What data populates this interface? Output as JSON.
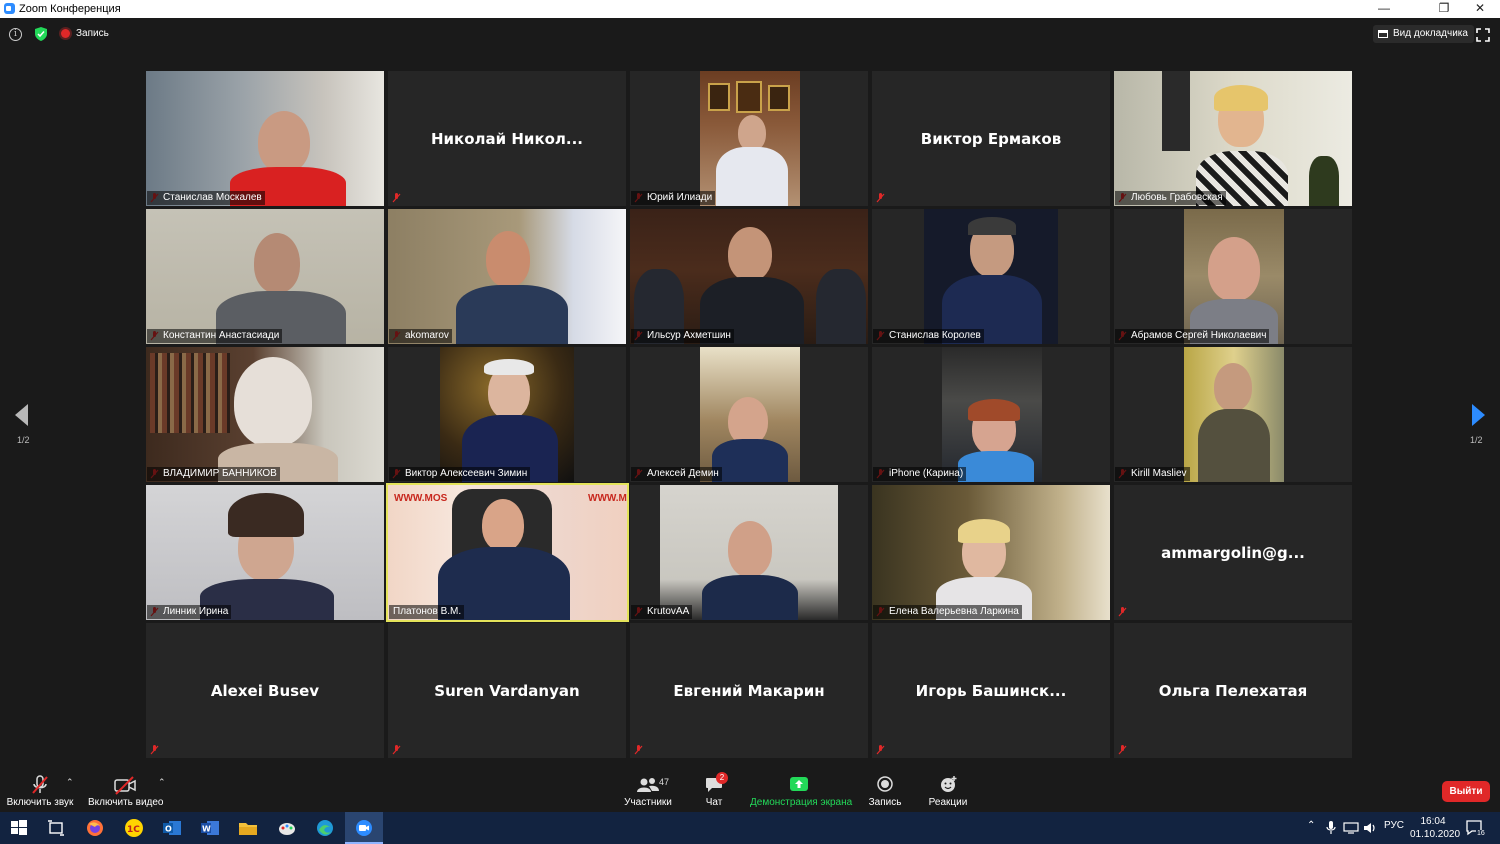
{
  "window": {
    "title": "Zoom Конференция",
    "minimize": "—",
    "restore": "❐",
    "close": "✕"
  },
  "topbar": {
    "record_label": "Запись",
    "speaker_view_label": "Вид докладчика",
    "info_glyph": "i"
  },
  "pagination": {
    "left": "1/2",
    "right": "1/2"
  },
  "colors": {
    "accent": "#2d8cff",
    "active_speaker": "#e4e35a",
    "leave": "#e02828",
    "share_green": "#23d959"
  },
  "participants": [
    {
      "name": "Станислав Москалев",
      "video": true
    },
    {
      "name": "Николай  Никол...",
      "video": false
    },
    {
      "name": "Юрий Илиади",
      "video": true
    },
    {
      "name": "Виктор Ермаков",
      "video": false
    },
    {
      "name": "Любовь Грабовская",
      "video": true
    },
    {
      "name": "Константин Анастасиади",
      "video": true
    },
    {
      "name": "akomarov",
      "video": true
    },
    {
      "name": "Ильсур Ахметшин",
      "video": true
    },
    {
      "name": "Станислав Королев",
      "video": true
    },
    {
      "name": "Абрамов Сергей Николаевич",
      "video": true
    },
    {
      "name": "ВЛАДИМИР БАННИКОВ",
      "video": true
    },
    {
      "name": "Виктор Алексеевич Зимин",
      "video": true
    },
    {
      "name": "Алексей Демин",
      "video": true
    },
    {
      "name": "iPhone (Карина)",
      "video": true
    },
    {
      "name": "Kirill Masliev",
      "video": true
    },
    {
      "name": "Линник Ирина",
      "video": true
    },
    {
      "name": "Платонов В.М.",
      "video": true,
      "active": true
    },
    {
      "name": "KrutovAA",
      "video": true
    },
    {
      "name": "Елена Валерьевна Ларкина",
      "video": true
    },
    {
      "name": "ammargolin@g...",
      "video": false
    },
    {
      "name": "Alexei Busev",
      "video": false
    },
    {
      "name": "Suren Vardanyan",
      "video": false
    },
    {
      "name": "Евгений Макарин",
      "video": false
    },
    {
      "name": "Игорь  Башинск...",
      "video": false
    },
    {
      "name": "Ольга Пелехатая",
      "video": false
    }
  ],
  "background_text": {
    "sign_left": "WWW.MOS",
    "sign_right": "WWW.M"
  },
  "toolbar": {
    "unmute_label": "Включить звук",
    "start_video_label": "Включить видео",
    "participants_label": "Участники",
    "participants_count": "47",
    "chat_label": "Чат",
    "chat_badge": "2",
    "share_label": "Демонстрация экрана",
    "record_label": "Запись",
    "reactions_label": "Реакции",
    "leave_label": "Выйти"
  },
  "taskbar": {
    "apps": [
      "windows-start",
      "task-view",
      "firefox",
      "1c",
      "outlook",
      "word",
      "file-explorer",
      "paint",
      "edge",
      "zoom"
    ],
    "lang": "РУС",
    "time": "16:04",
    "date": "01.10.2020",
    "notifications": "16"
  }
}
